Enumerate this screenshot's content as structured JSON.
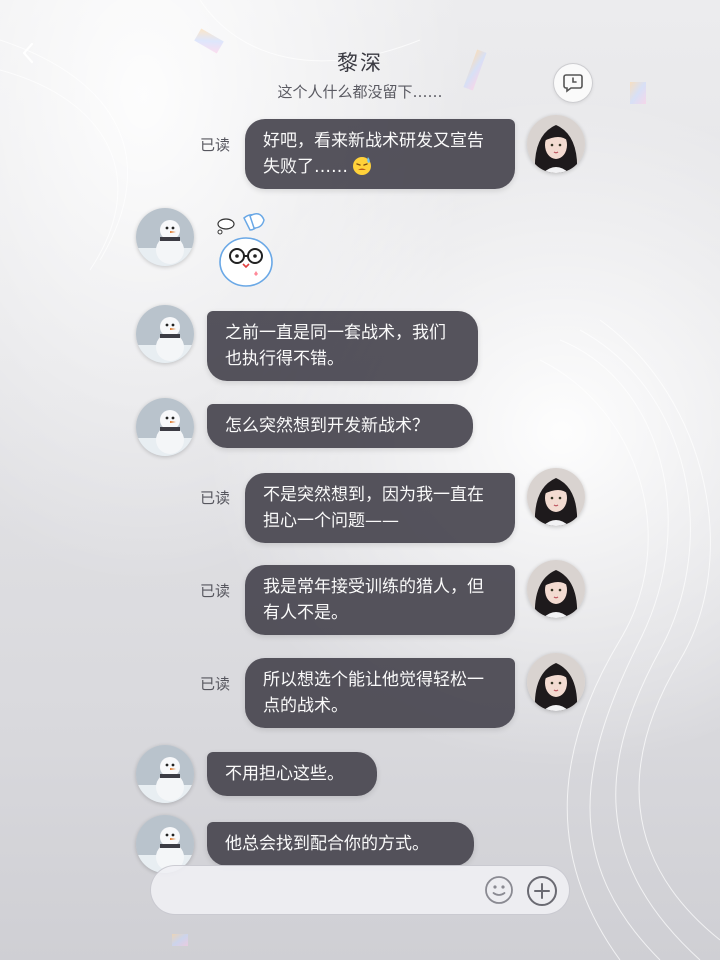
{
  "header": {
    "title": "黎深",
    "subtitle": "这个人什么都没留下……"
  },
  "messages": [
    {
      "side": "right",
      "text": "好吧，看来新战术研发又宣告失败了……",
      "emoji": "sweating-face",
      "read": "已读"
    },
    {
      "side": "left",
      "sticker": "snow-bunny-with-glasses-sticker"
    },
    {
      "side": "left",
      "text": "之前一直是同一套战术，我们也执行得不错。"
    },
    {
      "side": "left",
      "text": "怎么突然想到开发新战术？"
    },
    {
      "side": "right",
      "text": "不是突然想到，因为我一直在担心一个问题——",
      "read": "已读"
    },
    {
      "side": "right",
      "text": "我是常年接受训练的猎人，但有人不是。",
      "read": "已读"
    },
    {
      "side": "right",
      "text": "所以想选个能让他觉得轻松一点的战术。",
      "read": "已读"
    },
    {
      "side": "left",
      "text": "不用担心这些。"
    },
    {
      "side": "left",
      "text": "他总会找到配合你的方式。"
    }
  ],
  "input": {
    "placeholder": ""
  },
  "icons": {
    "back": "chevron-left-icon",
    "moment": "chat-clock-icon",
    "emoji": "emoji-icon",
    "plus": "plus-circle-icon"
  },
  "colors": {
    "bubble": "#4a4852",
    "bubble_text": "#fafafa",
    "background": "#e4e4e7"
  }
}
